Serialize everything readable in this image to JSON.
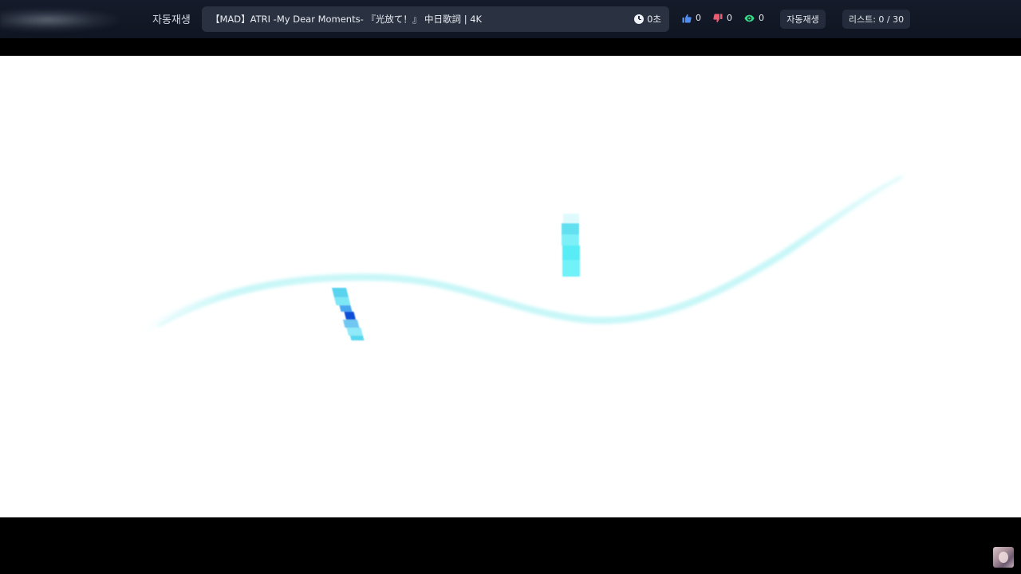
{
  "header": {
    "autoplay_label": "자동재생",
    "video_title": "【MAD】ATRI -My Dear Moments- 『光放て！』 中日歌詞 | 4K",
    "elapsed_time": "0초",
    "likes": "0",
    "dislikes": "0",
    "views": "0",
    "autoplay_button_label": "자동재생",
    "playlist_label": "리스트: 0 / 30"
  },
  "colors": {
    "topbar": "#121827",
    "title_box": "#2a3242",
    "like": "#4d8ef5",
    "dislike": "#f05a6e",
    "views": "#39d98a",
    "video_accent": "#55e6f2"
  },
  "icons": {
    "clock": "clock-icon",
    "like": "thumbs-up-icon",
    "dislike": "thumbs-down-icon",
    "views": "eye-icon"
  }
}
